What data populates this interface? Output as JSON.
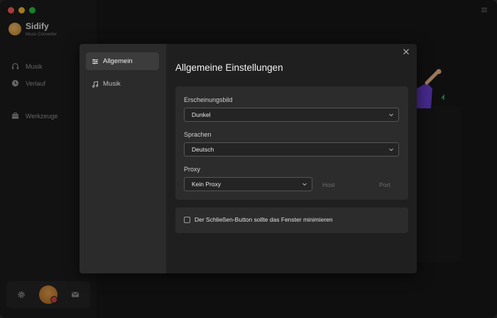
{
  "app": {
    "name": "Sidify",
    "subtitle": "Music Converter"
  },
  "sidebar": {
    "items": [
      {
        "label": "Musik",
        "icon": "headphones-icon"
      },
      {
        "label": "Verlauf",
        "icon": "clock-icon"
      },
      {
        "label": "Werkzeuge",
        "icon": "toolbox-icon"
      }
    ]
  },
  "settings": {
    "nav": [
      {
        "label": "Allgemein",
        "icon": "sliders-icon"
      },
      {
        "label": "Musik",
        "icon": "music-note-icon"
      }
    ],
    "title": "Allgemeine Einstellungen",
    "appearance": {
      "label": "Erscheinungsbild",
      "value": "Dunkel"
    },
    "language": {
      "label": "Sprachen",
      "value": "Deutsch"
    },
    "proxy": {
      "label": "Proxy",
      "value": "Kein Proxy",
      "host_placeholder": "Host",
      "port_placeholder": "Port"
    },
    "minimize_on_close": {
      "label": "Der Schließen-Button sollte das Fenster minimieren",
      "checked": false
    }
  },
  "colors": {
    "accent_avatar": "#e6a04e",
    "badge": "#d64545",
    "background": "#171717"
  }
}
